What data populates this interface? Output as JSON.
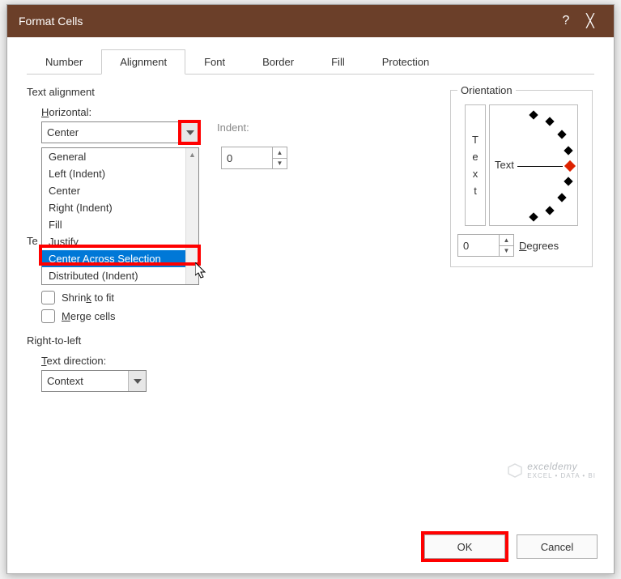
{
  "titlebar": {
    "title": "Format Cells",
    "help": "?",
    "close": "╳"
  },
  "tabs": [
    {
      "label": "Number"
    },
    {
      "label": "Alignment",
      "active": true
    },
    {
      "label": "Font"
    },
    {
      "label": "Border"
    },
    {
      "label": "Fill"
    },
    {
      "label": "Protection"
    }
  ],
  "textAlignment": {
    "groupTitle": "Text alignment",
    "horizontal": {
      "label": "Horizontal:",
      "labelAccel": "H",
      "value": "Center",
      "options": [
        "General",
        "Left (Indent)",
        "Center",
        "Right (Indent)",
        "Fill",
        "Justify",
        "Center Across Selection",
        "Distributed (Indent)"
      ],
      "selectedOption": "Center Across Selection"
    },
    "indent": {
      "label": "Indent:",
      "value": "0",
      "disabled": true
    },
    "textControlFragment": "Te",
    "shrink": {
      "label": "Shrink to fit",
      "accel": "k"
    },
    "merge": {
      "label": "Merge cells",
      "accel": "M"
    }
  },
  "rtl": {
    "groupTitle": "Right-to-left",
    "textDirection": {
      "label": "Text direction:",
      "accel": "T",
      "value": "Context"
    }
  },
  "orientation": {
    "groupTitle": "Orientation",
    "verticalText": [
      "T",
      "e",
      "x",
      "t"
    ],
    "dialLabel": "Text",
    "degrees": {
      "value": "0",
      "label": "Degrees",
      "accel": "D"
    }
  },
  "buttons": {
    "ok": "OK",
    "cancel": "Cancel"
  },
  "watermark": {
    "brand": "exceldemy",
    "sub": "EXCEL • DATA • BI"
  }
}
